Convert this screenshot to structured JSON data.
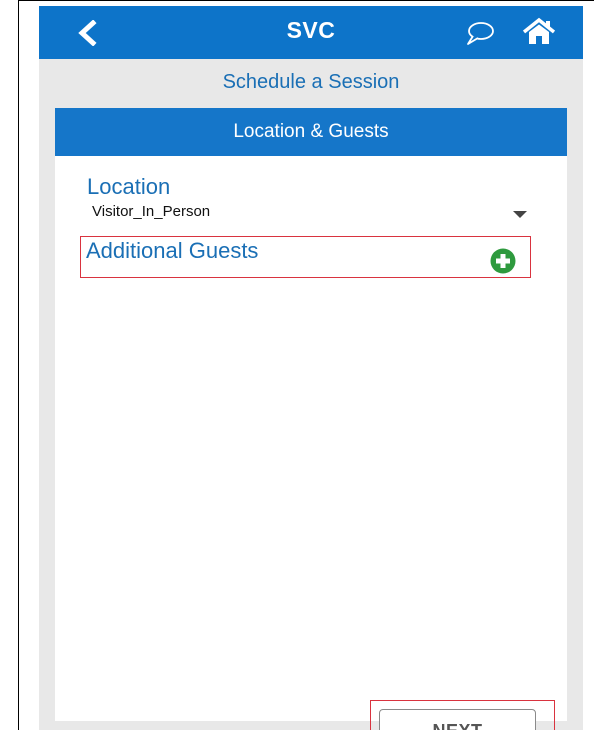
{
  "app_bar": {
    "title": "SVC",
    "back_icon": "chevron-left-icon",
    "chat_icon": "chat-bubble-icon",
    "home_icon": "home-icon"
  },
  "page": {
    "subtitle": "Schedule a Session"
  },
  "card": {
    "header": "Location & Guests",
    "location": {
      "label": "Location",
      "selected_value": "Visitor_In_Person"
    },
    "guests": {
      "label": "Additional Guests",
      "add_icon": "plus-circle-icon"
    },
    "next_label": "NEXT"
  },
  "colors": {
    "app_bar_bg": "#0d74c9",
    "accent_text": "#1a6fb5",
    "highlight_border": "#d9333f",
    "add_button": "#2e9a3e",
    "background": "#e8e8e8"
  }
}
